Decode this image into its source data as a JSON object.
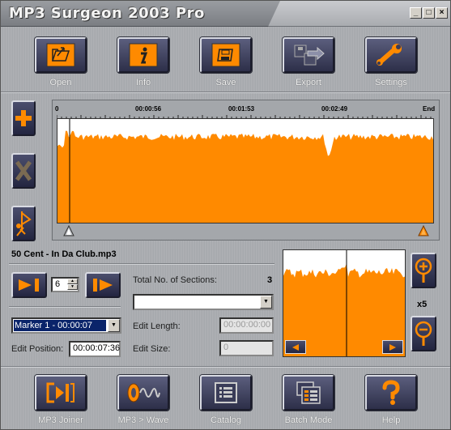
{
  "window": {
    "title": "MP3 Surgeon 2003 Pro",
    "minimize": "_",
    "maximize": "□",
    "close": "×"
  },
  "toolbar": [
    {
      "label": "Open",
      "icon": "open-folder-icon"
    },
    {
      "label": "Info",
      "icon": "info-icon"
    },
    {
      "label": "Save",
      "icon": "save-disk-icon"
    },
    {
      "label": "Export",
      "icon": "export-icon"
    },
    {
      "label": "Settings",
      "icon": "settings-wrench-icon"
    }
  ],
  "timeline": {
    "labels": [
      "0",
      "00:00:56",
      "00:01:53",
      "00:02:49",
      "End"
    ]
  },
  "file": {
    "name": "50 Cent - In Da Club.mp3"
  },
  "sections": {
    "total_label": "Total No. of Sections:",
    "total_value": "3",
    "spin_value": "6",
    "section_combo": ""
  },
  "marker": {
    "selected": "Marker 1 - 00:00:07"
  },
  "edit": {
    "position_label": "Edit Position:",
    "position_value": "00:00:07:36",
    "length_label": "Edit Length:",
    "length_value": "00:00:00:00",
    "size_label": "Edit Size:",
    "size_value": "0"
  },
  "zoom": {
    "factor": "x5"
  },
  "bottom_toolbar": [
    {
      "label": "MP3 Joiner",
      "icon": "joiner-icon"
    },
    {
      "label": "MP3 > Wave",
      "icon": "speaker-wave-icon"
    },
    {
      "label": "Catalog",
      "icon": "catalog-list-icon"
    },
    {
      "label": "Batch Mode",
      "icon": "batch-files-icon"
    },
    {
      "label": "Help",
      "icon": "help-question-icon"
    }
  ],
  "colors": {
    "waveform": "#ff8a00",
    "button_face": "#2d2f49",
    "accent": "#ff8a00"
  }
}
